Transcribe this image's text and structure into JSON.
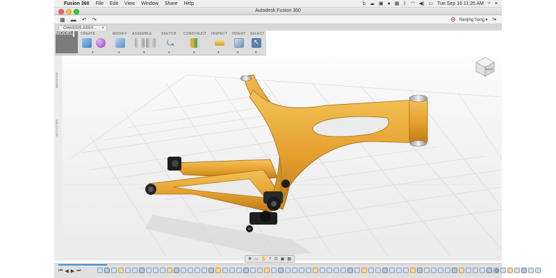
{
  "menubar": {
    "app": "Fusion 360",
    "items": [
      "File",
      "Edit",
      "View",
      "Window",
      "Share",
      "Help"
    ],
    "clock": "Tue Sep 16  11:26 AM"
  },
  "window": {
    "title": "Autodesk Fusion 360"
  },
  "toolbar": {
    "user": "Nanjing Song ▾",
    "help": "?▾"
  },
  "tab": {
    "label": "CHASSIS ASSY...",
    "close": "×"
  },
  "ribbon": {
    "groups": [
      "MODEL",
      "CREATE",
      "MODIFY",
      "ASSEMBLE",
      "SKETCH",
      "CONSTRUCT",
      "INSPECT",
      "INSERT",
      "SELECT"
    ],
    "caret": "▾"
  },
  "browser": {
    "label1": "BROWSER",
    "label2": "ACTIVITIES"
  },
  "viewcube": {
    "label": "BACK"
  },
  "timeline": {
    "buttons": [
      "⏮",
      "◀",
      "▶",
      "⏭"
    ],
    "feature_count": 64
  },
  "colors": {
    "frame": "#e8a632",
    "frame_dark": "#b97a17",
    "select": "#5a7fa8",
    "accent": "#4a90d9"
  }
}
